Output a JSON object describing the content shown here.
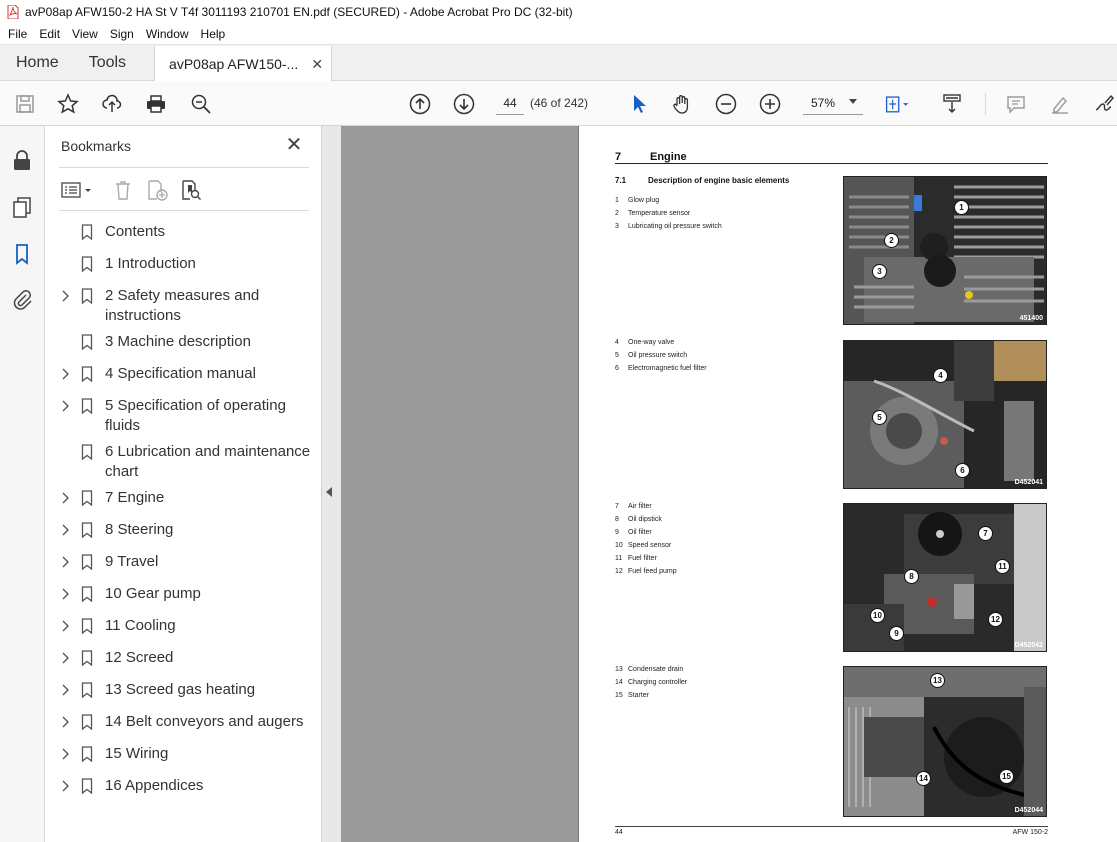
{
  "window": {
    "title": "avP08ap AFW150-2 HA St V T4f 3011193 210701 EN.pdf (SECURED) - Adobe Acrobat Pro DC (32-bit)"
  },
  "menu": [
    "File",
    "Edit",
    "View",
    "Sign",
    "Window",
    "Help"
  ],
  "tabs": {
    "home": "Home",
    "tools": "Tools",
    "document": "avP08ap AFW150-..."
  },
  "toolbar": {
    "page_current": "44",
    "page_count": "(46 of 242)",
    "zoom": "57%"
  },
  "bookmarks": {
    "title": "Bookmarks",
    "items": [
      {
        "label": "Contents",
        "expandable": false
      },
      {
        "label": "1 Introduction",
        "expandable": false
      },
      {
        "label": "2 Safety measures and instructions",
        "expandable": true
      },
      {
        "label": "3 Machine description",
        "expandable": false
      },
      {
        "label": "4 Specification manual",
        "expandable": true
      },
      {
        "label": "5 Specification of operating fluids",
        "expandable": true
      },
      {
        "label": "6 Lubrication and maintenance chart",
        "expandable": false
      },
      {
        "label": "7 Engine",
        "expandable": true
      },
      {
        "label": "8 Steering",
        "expandable": true
      },
      {
        "label": "9 Travel",
        "expandable": true
      },
      {
        "label": "10 Gear pump",
        "expandable": true
      },
      {
        "label": "11 Cooling",
        "expandable": true
      },
      {
        "label": "12 Screed",
        "expandable": true
      },
      {
        "label": "13 Screed gas heating",
        "expandable": true
      },
      {
        "label": "14 Belt conveyors and augers",
        "expandable": true
      },
      {
        "label": "15 Wiring",
        "expandable": true
      },
      {
        "label": "16 Appendices",
        "expandable": true
      }
    ]
  },
  "page": {
    "chapter_number": "7",
    "chapter_title": "Engine",
    "section_number": "7.1",
    "section_title": "Description of engine basic elements",
    "figures": [
      {
        "code": "451400",
        "legend": [
          [
            "1",
            "Glow plug"
          ],
          [
            "2",
            "Temperature sensor"
          ],
          [
            "3",
            "Lubricating oil pressure switch"
          ]
        ]
      },
      {
        "code": "D452041",
        "legend": [
          [
            "4",
            "One-way valve"
          ],
          [
            "5",
            "Oil pressure switch"
          ],
          [
            "6",
            "Electromagnetic fuel filter"
          ]
        ]
      },
      {
        "code": "D452042",
        "legend": [
          [
            "7",
            "Air filter"
          ],
          [
            "8",
            "Oil dipstick"
          ],
          [
            "9",
            "Oil filter"
          ],
          [
            "10",
            "Speed sensor"
          ],
          [
            "11",
            "Fuel filter"
          ],
          [
            "12",
            "Fuel feed pump"
          ]
        ]
      },
      {
        "code": "D452044",
        "legend": [
          [
            "13",
            "Condensate drain"
          ],
          [
            "14",
            "Charging controller"
          ],
          [
            "15",
            "Starter"
          ]
        ]
      }
    ],
    "footer_left": "44",
    "footer_right": "AFW 150-2"
  }
}
